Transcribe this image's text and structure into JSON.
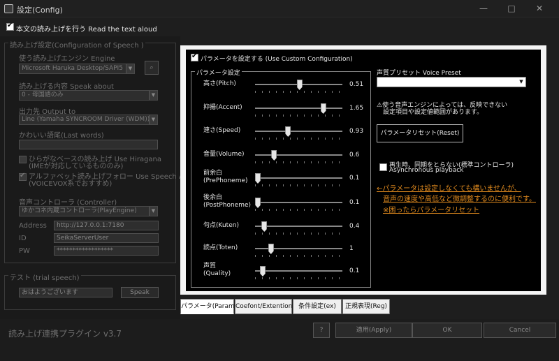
{
  "window": {
    "title": "設定(Config)",
    "minimize": "—",
    "maximize": "□",
    "close": "✕"
  },
  "top": {
    "read_aloud_label": "本文の読み上げを行う  Read the text aloud",
    "read_aloud_checked": true
  },
  "left": {
    "speech_group_title": "読み上げ設定(Configuration of Speech )",
    "engine_label": "使う読み上げエンジン  Engine",
    "engine_value": "Microsoft Haruka Desktop/SAPI5",
    "speak_about_label": "読み上げる内容  Speak about",
    "speak_about_value": "0 - 母国語のみ",
    "output_label": "出力先   Output to",
    "output_value": "Line (Yamaha SYNCROOM Driver (WDM))",
    "last_words_label": "かわいい語尾(Last words)",
    "last_words_value": "",
    "hiragana_label_1": "ひらがなベースの読み上げ  Use Hiragana",
    "hiragana_label_2": "(IMEが対応しているもののみ)",
    "assist_label_1": "アルファベット読み上げフォロー  Use Speech Assist",
    "assist_label_2": "(VOICEVOX系でおすすめ)",
    "controller_label": "音声コントローラ (Controller)",
    "controller_value": "ゆかコネ内蔵コントローラ(PlayEngine)",
    "address_label": "Address",
    "address_value": "http://127.0.0.1:7180",
    "id_label": "ID",
    "id_value": "SeikaServerUser",
    "pw_label": "PW",
    "pw_value": "******************",
    "trial_group_title": "テスト (trial speech)",
    "trial_value": "おはようございます",
    "speak_button": "Speak"
  },
  "right": {
    "custom_config_label": "パラメータを設定する (Use Custom Configuration)",
    "param_group_title": "パラメータ設定",
    "sliders": [
      {
        "label": "高さ(Pitch)",
        "value": "0.51",
        "pos": 0.51
      },
      {
        "label": "抑揚(Accent)",
        "value": "1.65",
        "pos": 0.8
      },
      {
        "label": "速さ(Speed)",
        "value": "0.93",
        "pos": 0.37
      },
      {
        "label": "音量(Volume)",
        "value": "0.6",
        "pos": 0.2
      },
      {
        "label": "前余白",
        "label2": "(PrePhoneme)",
        "value": "0.1",
        "pos": 0.0
      },
      {
        "label": "後余白",
        "label2": "(PostPhoneme)",
        "value": "0.1",
        "pos": 0.0
      },
      {
        "label": "句点(Kuten)",
        "value": "0.4",
        "pos": 0.08
      },
      {
        "label": "読点(Toten)",
        "value": "1",
        "pos": 0.16
      },
      {
        "label": "声質",
        "label2": "(Quality)",
        "value": "0.1",
        "pos": 0.06
      }
    ],
    "voice_preset_label": "声質プリセット  Voice Preset",
    "voice_preset_value": "",
    "warning_1": "⚠使う音声エンジンによっては、反映できない",
    "warning_2": "設定項目や設定値範囲があります。",
    "reset_button": "パラメータリセット(Reset)",
    "async_label_1": "再生時、同期をとらない(標準コントローラ)",
    "async_label_2": "Asynchronous playback",
    "hint_1": "←パラメータは設定しなくても構いませんが、",
    "hint_2": "音声の速度や高低など微調整するのに便利です。",
    "hint_3": "※困ったらパラメータリセット"
  },
  "tabs": [
    "パラメータ(Param)",
    "Coefont/Extention",
    "条件設定(ex)",
    "正規表現(Reg)"
  ],
  "bottom": {
    "version": "読み上げ連携プラグイン v3.7",
    "help_button": "?",
    "apply_button": "適用(Apply)",
    "ok_button": "OK",
    "cancel_button": "Cancel"
  }
}
